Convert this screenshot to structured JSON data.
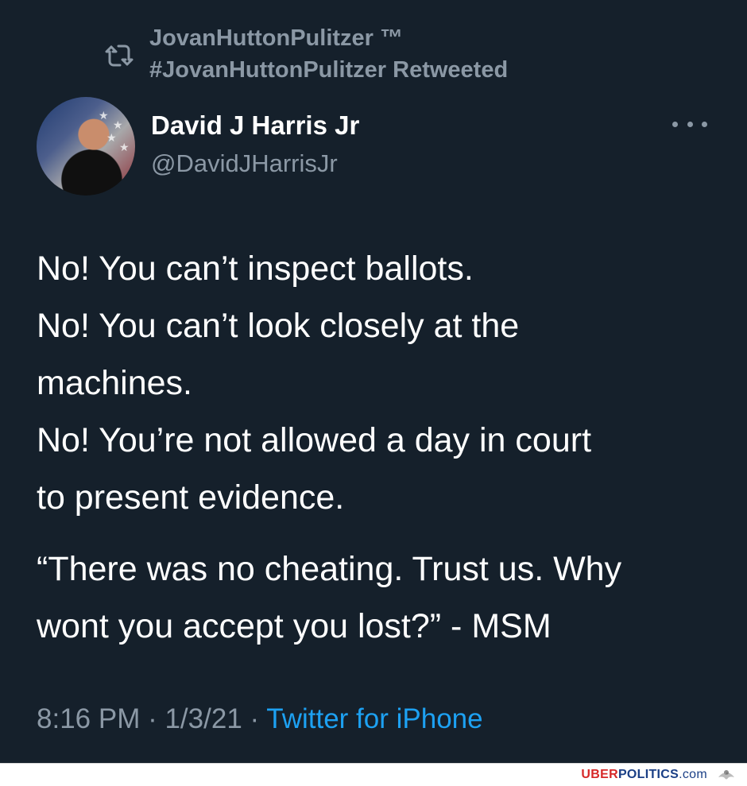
{
  "retweet": {
    "line1": "JovanHuttonPulitzer ™",
    "line2": "#JovanHuttonPulitzer Retweeted",
    "icon": "retweet-icon"
  },
  "author": {
    "display_name": "David J Harris Jr",
    "handle": "@DavidJHarrisJr",
    "avatar_icon": "avatar"
  },
  "menu": {
    "icon": "more-icon"
  },
  "tweet": {
    "paragraph1": "No! You can’t inspect ballots.\nNo! You can’t look closely at the\nmachines.\nNo! You’re not allowed a day in court\nto present evidence.",
    "paragraph2": "“There was no cheating. Trust us. Why\nwont you accept you lost?” - MSM"
  },
  "meta": {
    "time": "8:16 PM",
    "separator1": " · ",
    "date": "1/3/21",
    "separator2": " · ",
    "source": "Twitter for iPhone"
  },
  "footer": {
    "brand_uber": "UBER",
    "brand_politics": "POLITICS",
    "brand_com": ".com",
    "icon": "eagle-icon"
  },
  "colors": {
    "background": "#15202b",
    "secondary_text": "#8b98a5",
    "link": "#1da1f2",
    "primary_text": "#ffffff"
  }
}
